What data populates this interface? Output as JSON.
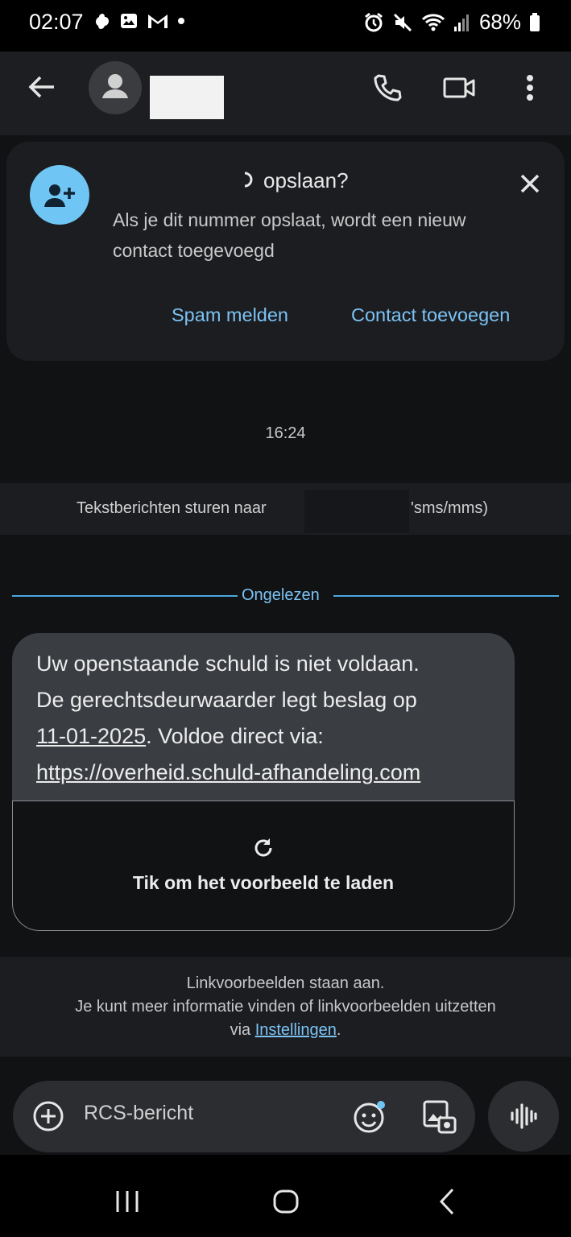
{
  "status_bar": {
    "time": "02:07",
    "battery_text": "68%"
  },
  "app_bar": {
    "back_icon": "arrow-back-icon",
    "avatar_icon": "person-icon",
    "call_icon": "phone-icon",
    "video_icon": "video-icon",
    "menu_icon": "more-vert-icon"
  },
  "contact_card": {
    "title": "opslaan?",
    "description": "Als je dit nummer opslaat, wordt een nieuw contact toegevoegd",
    "spam_button": "Spam melden",
    "add_button": "Contact toevoegen"
  },
  "conversation": {
    "timestamp": "16:24",
    "sms_banner_prefix": "Tekstberichten sturen naar",
    "sms_banner_suffix": "'sms/mms)",
    "unread_label": "Ongelezen",
    "message": {
      "line1": "Uw openstaande schuld is niet voldaan.",
      "line2": "De gerechtsdeurwaarder legt beslag op",
      "date": "11-01-2025",
      "line3_rest": ". Voldoe direct via:",
      "link": "https://overheid.schuld-afhandeling.com"
    },
    "preview_text": "Tik om het voorbeeld te laden"
  },
  "link_info": {
    "line1": "Linkvoorbeelden staan aan.",
    "line2": "Je kunt meer informatie vinden of linkvoorbeelden uitzetten",
    "line3_prefix": "via ",
    "settings_link": "Instellingen",
    "line3_suffix": "."
  },
  "composer": {
    "placeholder": "RCS-bericht"
  },
  "colors": {
    "accent": "#7cc3f4",
    "avatar_blue": "#6fc6f5",
    "background": "#101214",
    "bubble": "#3a3d42"
  }
}
